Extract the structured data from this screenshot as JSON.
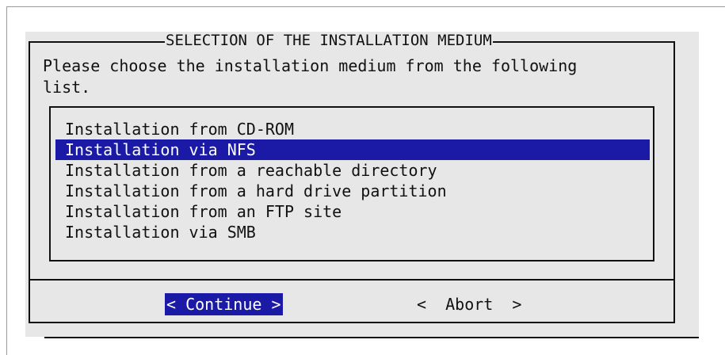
{
  "dialog": {
    "title": "SELECTION OF THE INSTALLATION MEDIUM",
    "prompt": "Please choose the installation medium from the following\nlist."
  },
  "list": {
    "items": [
      "Installation from CD-ROM",
      "Installation via NFS",
      "Installation from a reachable directory",
      "Installation from a hard drive partition",
      "Installation from an FTP site",
      "Installation via SMB"
    ],
    "selected_index": 1
  },
  "buttons": {
    "continue": "< Continue >",
    "abort": "<  Abort  >"
  },
  "colors": {
    "highlight": "#1a1aa6",
    "background": "#e7e7e7",
    "frame": "#111111"
  }
}
